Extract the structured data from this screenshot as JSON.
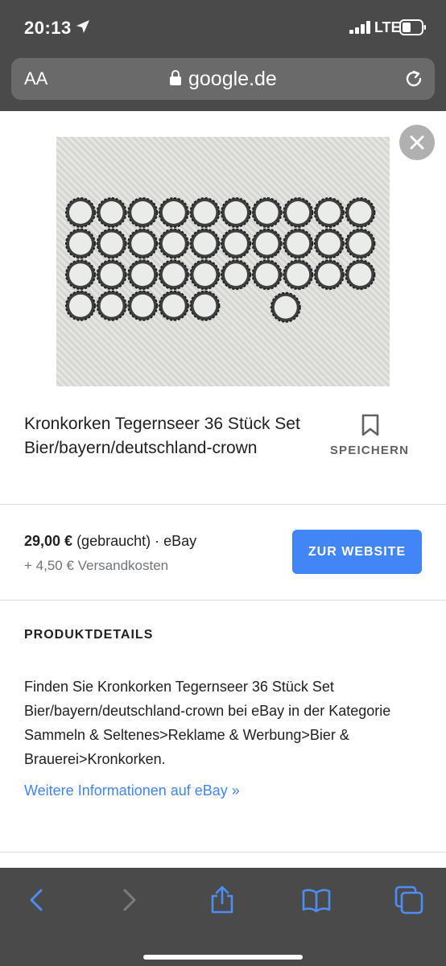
{
  "status_bar": {
    "time": "20:13",
    "network": "LTE",
    "icons": [
      "location-arrow-icon",
      "signal-bars-icon",
      "battery-icon"
    ]
  },
  "address_bar": {
    "text_size_label": "AA",
    "domain": "google.de",
    "icons": [
      "lock-icon",
      "reload-icon"
    ]
  },
  "product": {
    "image_alt_icon": "product-photo",
    "title": "Kronkorken Tegernseer 36 Stück Set Bier/bayern/deutschland-crown",
    "save_label": "SPEICHERN",
    "price": "29,00 €",
    "condition": " (gebraucht) · eBay",
    "shipping": "+ 4,50 € Versandkosten",
    "cta_label": "ZUR WEBSITE"
  },
  "details": {
    "heading": "PRODUKTDETAILS",
    "description": "Finden Sie Kronkorken Tegernseer 36 Stück Set Bier/bayern/deutschland-crown bei eBay in der Kategorie Sammeln & Seltenes>Reklame & Werbung>Bier & Brauerei>Kronkorken.",
    "more_link": "Weitere Informationen auf eBay »"
  },
  "toolbar": {
    "items": [
      "back-icon",
      "forward-icon",
      "share-icon",
      "bookmarks-icon",
      "tabs-icon"
    ]
  },
  "colors": {
    "chrome_background": "#4a4a4a",
    "accent_blue": "#4285f4",
    "text_primary": "#202124",
    "text_secondary": "#70757a"
  }
}
